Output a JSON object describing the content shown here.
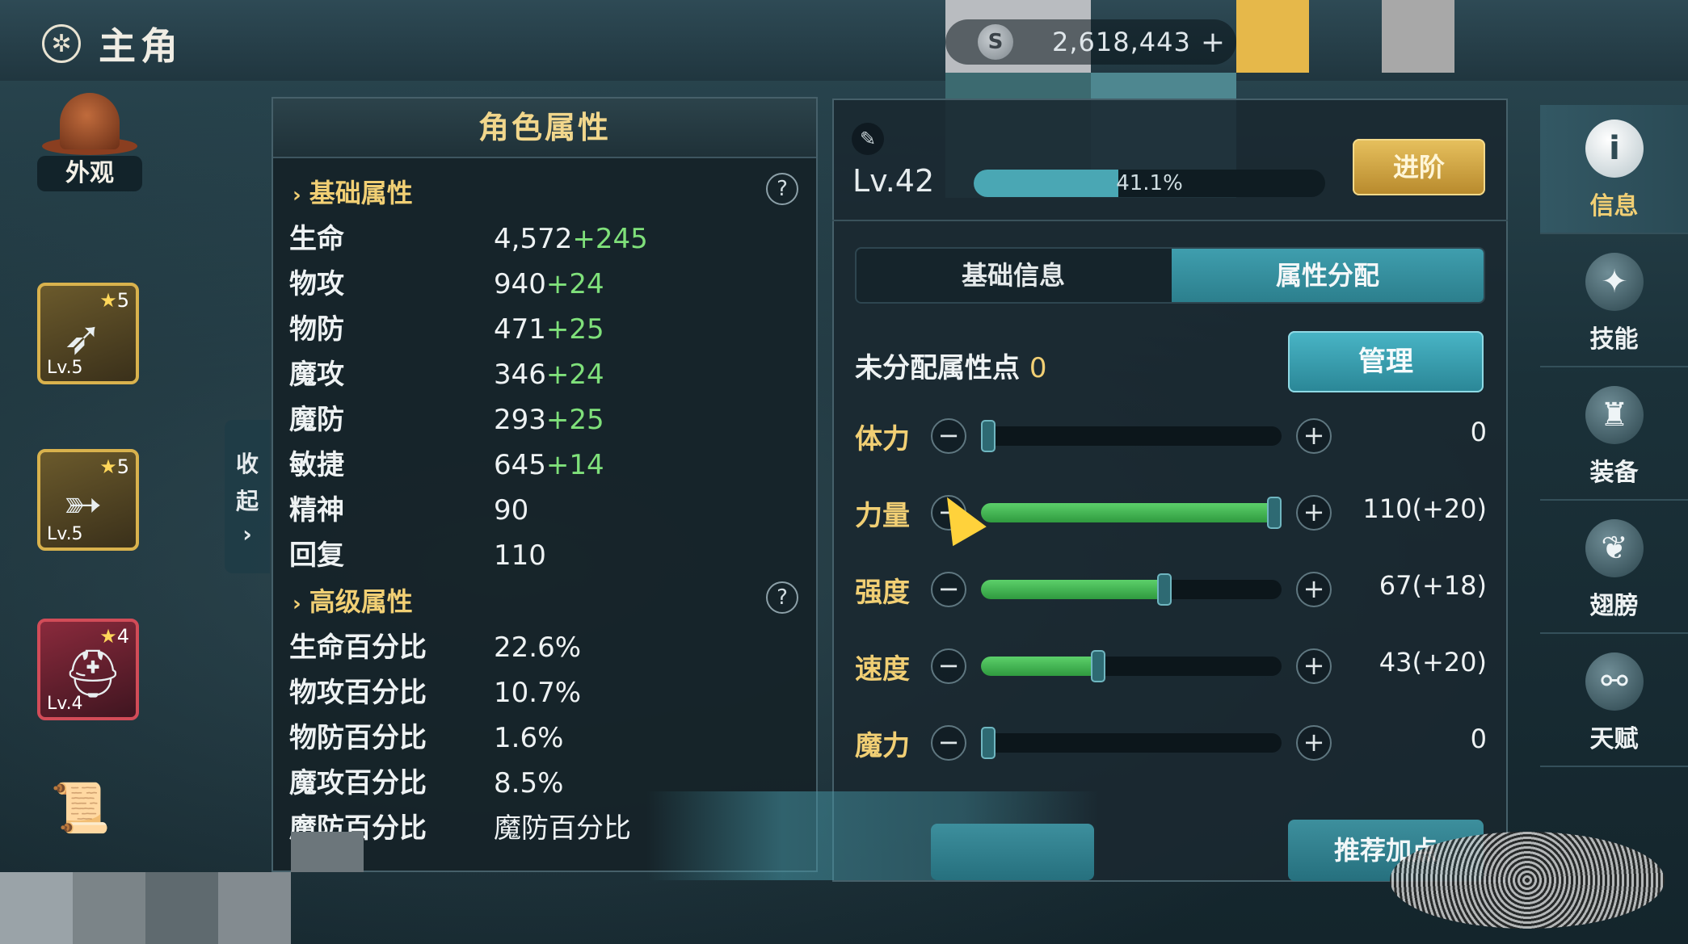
{
  "header": {
    "title": "主角",
    "icon": "gear-icon"
  },
  "currency": {
    "amount": "2,618,443",
    "plus": "+",
    "coin_symbol": "S"
  },
  "left_column": {
    "appearance_label": "外观",
    "items": [
      {
        "stars": "5",
        "level": "Lv.5",
        "icon": "arrows-icon"
      },
      {
        "stars": "5",
        "level": "Lv.5",
        "icon": "bow-icon"
      },
      {
        "stars": "4",
        "level": "Lv.4",
        "icon": "helmet-icon"
      }
    ]
  },
  "collapse_tab": {
    "char1": "收",
    "char2": "起",
    "arrow": "›"
  },
  "attr_panel": {
    "title": "角色属性",
    "basic": {
      "title": "基础属性",
      "help": "?",
      "stats": [
        {
          "name": "生命",
          "value": "4,572",
          "bonus": "+245"
        },
        {
          "name": "物攻",
          "value": "940",
          "bonus": "+24"
        },
        {
          "name": "物防",
          "value": "471",
          "bonus": "+25"
        },
        {
          "name": "魔攻",
          "value": "346",
          "bonus": "+24"
        },
        {
          "name": "魔防",
          "value": "293",
          "bonus": "+25"
        },
        {
          "name": "敏捷",
          "value": "645",
          "bonus": "+14"
        },
        {
          "name": "精神",
          "value": "90",
          "bonus": ""
        },
        {
          "name": "回复",
          "value": "110",
          "bonus": ""
        }
      ]
    },
    "advanced": {
      "title": "高级属性",
      "help": "?",
      "stats": [
        {
          "name": "生命百分比",
          "value": "22.6%"
        },
        {
          "name": "物攻百分比",
          "value": "10.7%"
        },
        {
          "name": "物防百分比",
          "value": "1.6%"
        },
        {
          "name": "魔攻百分比",
          "value": "8.5%"
        },
        {
          "name": "魔防百分比",
          "value": "魔防百分比"
        }
      ]
    }
  },
  "info_panel": {
    "level": "Lv.42",
    "exp_percent": "41.1%",
    "exp_fraction": 0.411,
    "advance_label": "进阶",
    "tabs": [
      "基础信息",
      "属性分配"
    ],
    "unassigned_label": "未分配属性点",
    "unassigned_points": "0",
    "manage_label": "管理",
    "minus": "−",
    "plus": "+",
    "sliders": [
      {
        "name": "体力",
        "value": "0",
        "fraction": 0.0
      },
      {
        "name": "力量",
        "value": "110(+20)",
        "fraction": 1.0
      },
      {
        "name": "强度",
        "value": "67(+18)",
        "fraction": 0.61
      },
      {
        "name": "速度",
        "value": "43(+20)",
        "fraction": 0.39
      },
      {
        "name": "魔力",
        "value": "0",
        "fraction": 0.0
      }
    ],
    "recommend_label": "推荐加点"
  },
  "right_nav": [
    {
      "label": "信息",
      "icon": "info-icon",
      "glyph": "i"
    },
    {
      "label": "技能",
      "icon": "skill-icon",
      "glyph": "✦"
    },
    {
      "label": "装备",
      "icon": "armor-icon",
      "glyph": "♜"
    },
    {
      "label": "翅膀",
      "icon": "wing-icon",
      "glyph": "❦"
    },
    {
      "label": "天赋",
      "icon": "talent-icon",
      "glyph": "⚯"
    }
  ],
  "colors": {
    "accent_gold": "#f1cf74",
    "bonus_green": "#7fe07a",
    "tab_active": "#3f9eae"
  }
}
